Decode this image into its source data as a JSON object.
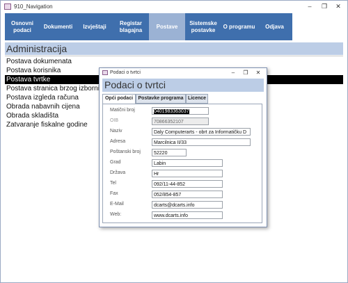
{
  "window": {
    "title": "910_Navigation"
  },
  "nav": {
    "buttons": [
      {
        "label": "Osnovni\npodaci"
      },
      {
        "label": "Dokumenti"
      },
      {
        "label": "Izvještaji"
      },
      {
        "label": "Registar\nblagajna"
      },
      {
        "label": "Postave"
      },
      {
        "label": "Sistemske\npostavke"
      },
      {
        "label": "O programu"
      },
      {
        "label": "Odjava"
      }
    ],
    "active": "Postave"
  },
  "main": {
    "title": "Administracija",
    "items": [
      {
        "label": "Postava dokumenata"
      },
      {
        "label": "Postava korisnika"
      },
      {
        "label": "Postava tvrtke"
      },
      {
        "label": "Postava stranica brzog izbornika"
      },
      {
        "label": "Postava izgleda računa"
      },
      {
        "label": "Obrada nabavnih cijena"
      },
      {
        "label": "Obrada skladišta"
      },
      {
        "label": "Zatvaranje fiskalne godine"
      }
    ],
    "selected_index": 2
  },
  "popup": {
    "title": "Podaci o tvrtci",
    "heading": "Podaci o tvrtci",
    "tabs": [
      {
        "label": "Opći podaci"
      },
      {
        "label": "Postavke programa"
      },
      {
        "label": "Licence"
      }
    ],
    "active_tab": "Opći podaci",
    "fields": [
      {
        "label": "Matični broj",
        "value": "0401983363037"
      },
      {
        "label": "OIB",
        "value": "70866352107"
      },
      {
        "label": "Naziv",
        "value": "Daly Computerarts - obrt za Informatičku D"
      },
      {
        "label": "Adresa",
        "value": "Marcilnica II/33"
      },
      {
        "label": "Poštanski broj",
        "value": "52220"
      },
      {
        "label": "Grad",
        "value": "Labin"
      },
      {
        "label": "Država",
        "value": "Hr"
      },
      {
        "label": "Tel",
        "value": "092/11-44-852"
      },
      {
        "label": "Fax",
        "value": "052/854-857"
      },
      {
        "label": "E-Mail",
        "value": "dcarts@dcarts.info"
      },
      {
        "label": "Web:",
        "value": "www.dcarts.info"
      }
    ]
  },
  "colors": {
    "nav_bg": "#3f6fad",
    "nav_active": "#9bb2d4",
    "heading_bg": "#bccde6",
    "selected_row": "#000000"
  }
}
